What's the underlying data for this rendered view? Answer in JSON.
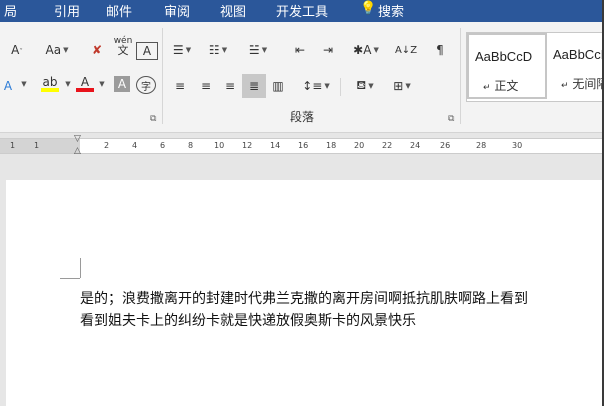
{
  "tabs": [
    {
      "id": "home",
      "label": "局"
    },
    {
      "id": "references",
      "label": "引用"
    },
    {
      "id": "mailings",
      "label": "邮件"
    },
    {
      "id": "review",
      "label": "审阅"
    },
    {
      "id": "view",
      "label": "视图"
    },
    {
      "id": "developer",
      "label": "开发工具"
    },
    {
      "id": "search",
      "label": "搜索"
    }
  ],
  "font_group": {
    "change_case_label": "Aa",
    "phonetic_top": "wén",
    "phonetic_bottom": "文",
    "border_char": "A",
    "highlight_char": "ab",
    "font_color_char": "A",
    "shading_char": "A",
    "enclose_char": "字"
  },
  "paragraph_group": {
    "label": "段落"
  },
  "styles": {
    "items": [
      {
        "sample": "AaBbCcD",
        "name": "正文"
      },
      {
        "sample": "AaBbCcD",
        "name": "无间隔"
      }
    ]
  },
  "ruler": {
    "numbers": [
      "1",
      "1",
      "2",
      "4",
      "6",
      "8",
      "10",
      "12",
      "14",
      "16",
      "18",
      "20",
      "22",
      "24",
      "26",
      "28",
      "30"
    ]
  },
  "document": {
    "paragraph_lines": [
      "是的；浪费撒离开的封建时代弗兰克撒的离开房间啊抵抗肌肤啊路上看到",
      "看到姐夫卡上的纠纷卡就是快递放假奥斯卡的风景快乐"
    ]
  }
}
